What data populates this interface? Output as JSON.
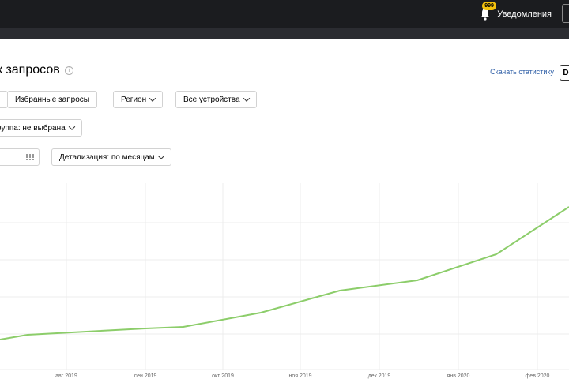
{
  "header": {
    "notifications": {
      "badge": "999",
      "label": "Уведомления"
    }
  },
  "page": {
    "title": "к запросов",
    "info_icon": "i",
    "download_link": "Скачать статистику",
    "download_button": "D"
  },
  "filters": {
    "favorites": "Избранные запросы",
    "region": "Регион",
    "devices": "Все устройства",
    "group": "руппа: не выбрана",
    "detail": "Детализация: по месяцам"
  },
  "chart_data": {
    "type": "line",
    "categories": [
      "авг 2019",
      "сен 2019",
      "окт 2019",
      "ноя 2019",
      "дек 2019",
      "янв 2020",
      "фев 2020"
    ],
    "series": [
      {
        "values": [
          6,
          12,
          15,
          21,
          30,
          40,
          60
        ]
      }
    ],
    "line_color": "#8ccd6a",
    "grid": true
  }
}
